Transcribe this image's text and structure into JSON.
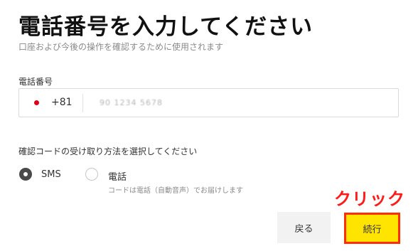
{
  "header": {
    "title": "電話番号を入力してください",
    "subtitle": "口座および今後の操作を確認するために使用されます"
  },
  "phone": {
    "label": "電話番号",
    "country_code": "+81",
    "flag_icon": "japan-flag-icon",
    "number_masked": "90 1234 5678"
  },
  "verification": {
    "label": "確認コードの受け取り方法を選択してください",
    "options": [
      {
        "label": "SMS",
        "selected": true
      },
      {
        "label": "電話",
        "selected": false,
        "hint": "コードは電話（自動音声）でお届けします"
      }
    ]
  },
  "buttons": {
    "back": "戻る",
    "continue": "続行"
  },
  "annotation": {
    "text": "クリック",
    "color": "#ff1a1a"
  },
  "colors": {
    "continue_button": "#ffe400",
    "highlight_border": "#ff2d00",
    "flag_red": "#e0001b"
  }
}
